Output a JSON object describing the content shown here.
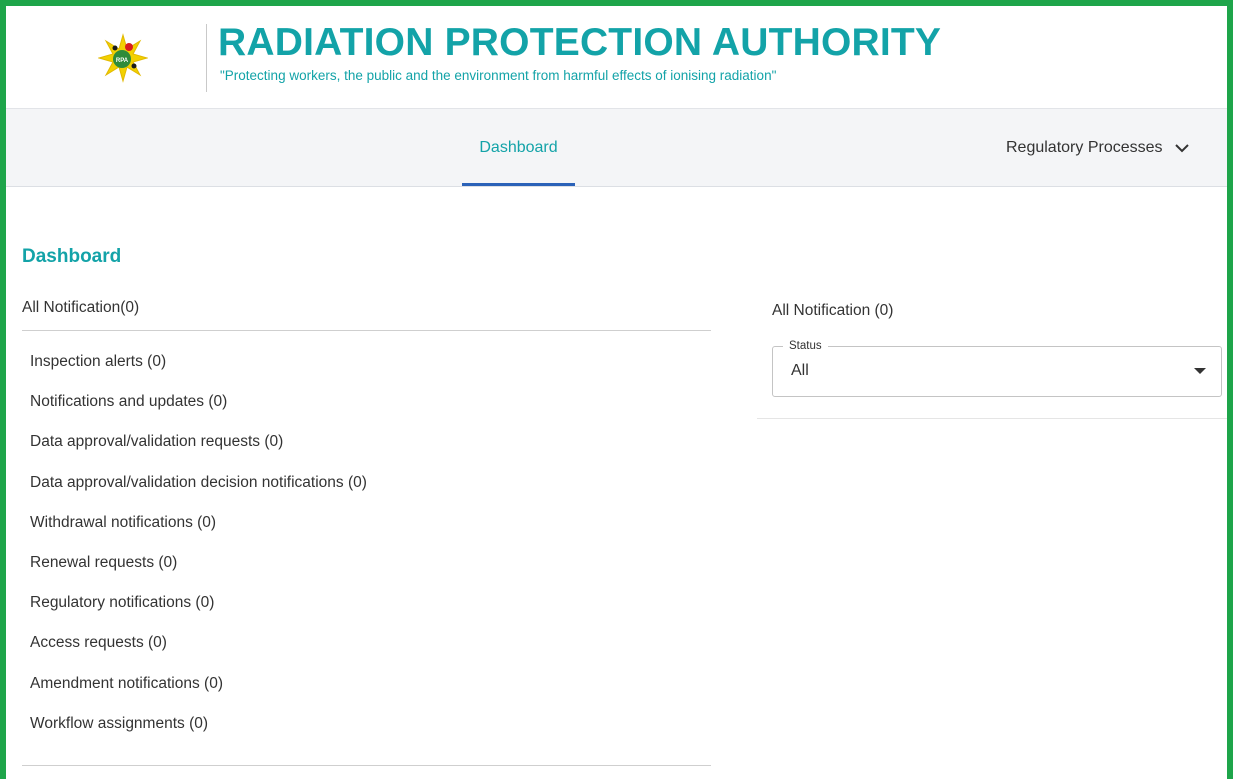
{
  "header": {
    "org_name": "RADIATION PROTECTION AUTHORITY",
    "tagline": "\"Protecting workers, the public and the environment from harmful effects of ionising radiation\"",
    "logo_text": "RPA"
  },
  "nav": {
    "tabs": [
      {
        "label": "Dashboard",
        "active": true
      },
      {
        "label": "Regulatory Processes",
        "has_dropdown": true
      }
    ]
  },
  "dashboard": {
    "title": "Dashboard",
    "all_notifications_label": "All Notification(0)",
    "categories": [
      "Inspection alerts (0)",
      "Notifications and updates (0)",
      "Data approval/validation requests (0)",
      "Data approval/validation decision notifications (0)",
      "Withdrawal notifications (0)",
      "Renewal requests (0)",
      "Regulatory notifications (0)",
      "Access requests (0)",
      "Amendment notifications (0)",
      "Workflow assignments (0)"
    ]
  },
  "notifications_panel": {
    "title": "All Notification (0)",
    "status_filter": {
      "label": "Status",
      "value": "All"
    }
  },
  "colors": {
    "frame_border": "#1ea54a",
    "brand_teal": "#13a3a8",
    "active_tab_underline": "#2b62b8",
    "nav_background": "#f4f5f7",
    "text": "#333333"
  },
  "icons": {
    "logo": "rpa-logo-icon",
    "dropdown": "chevron-down-icon",
    "select_caret": "caret-down-icon"
  }
}
